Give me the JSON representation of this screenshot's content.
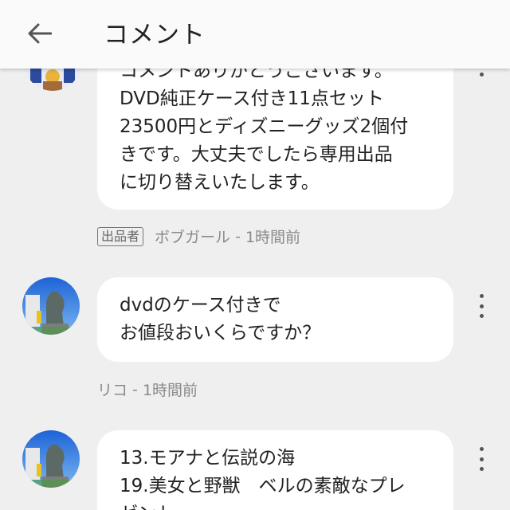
{
  "header": {
    "title": "コメント",
    "back_icon": "arrow-left-icon"
  },
  "comments": [
    {
      "lines": [
        "コメントありがとうございます。",
        "DVD純正ケース付き11点セット",
        "23500円とディズニーグッズ2個付",
        "きです。大丈夫でしたら専用出品",
        "に切り替えいたします。"
      ],
      "badge": "出品者",
      "author": "ボブガール",
      "time": "1時間前"
    },
    {
      "lines": [
        "dvdのケース付きで",
        "お値段おいくらですか？"
      ],
      "author": "リコ",
      "time": "1時間前"
    },
    {
      "lines": [
        "13.モアナと伝説の海",
        "19.美女と野獣　ベルの素敵なプレ",
        "ゼント"
      ]
    }
  ],
  "meta_separator": " - ",
  "colors": {
    "background": "#efefef",
    "bubble": "#ffffff",
    "meta_text": "#8a8a8a"
  }
}
